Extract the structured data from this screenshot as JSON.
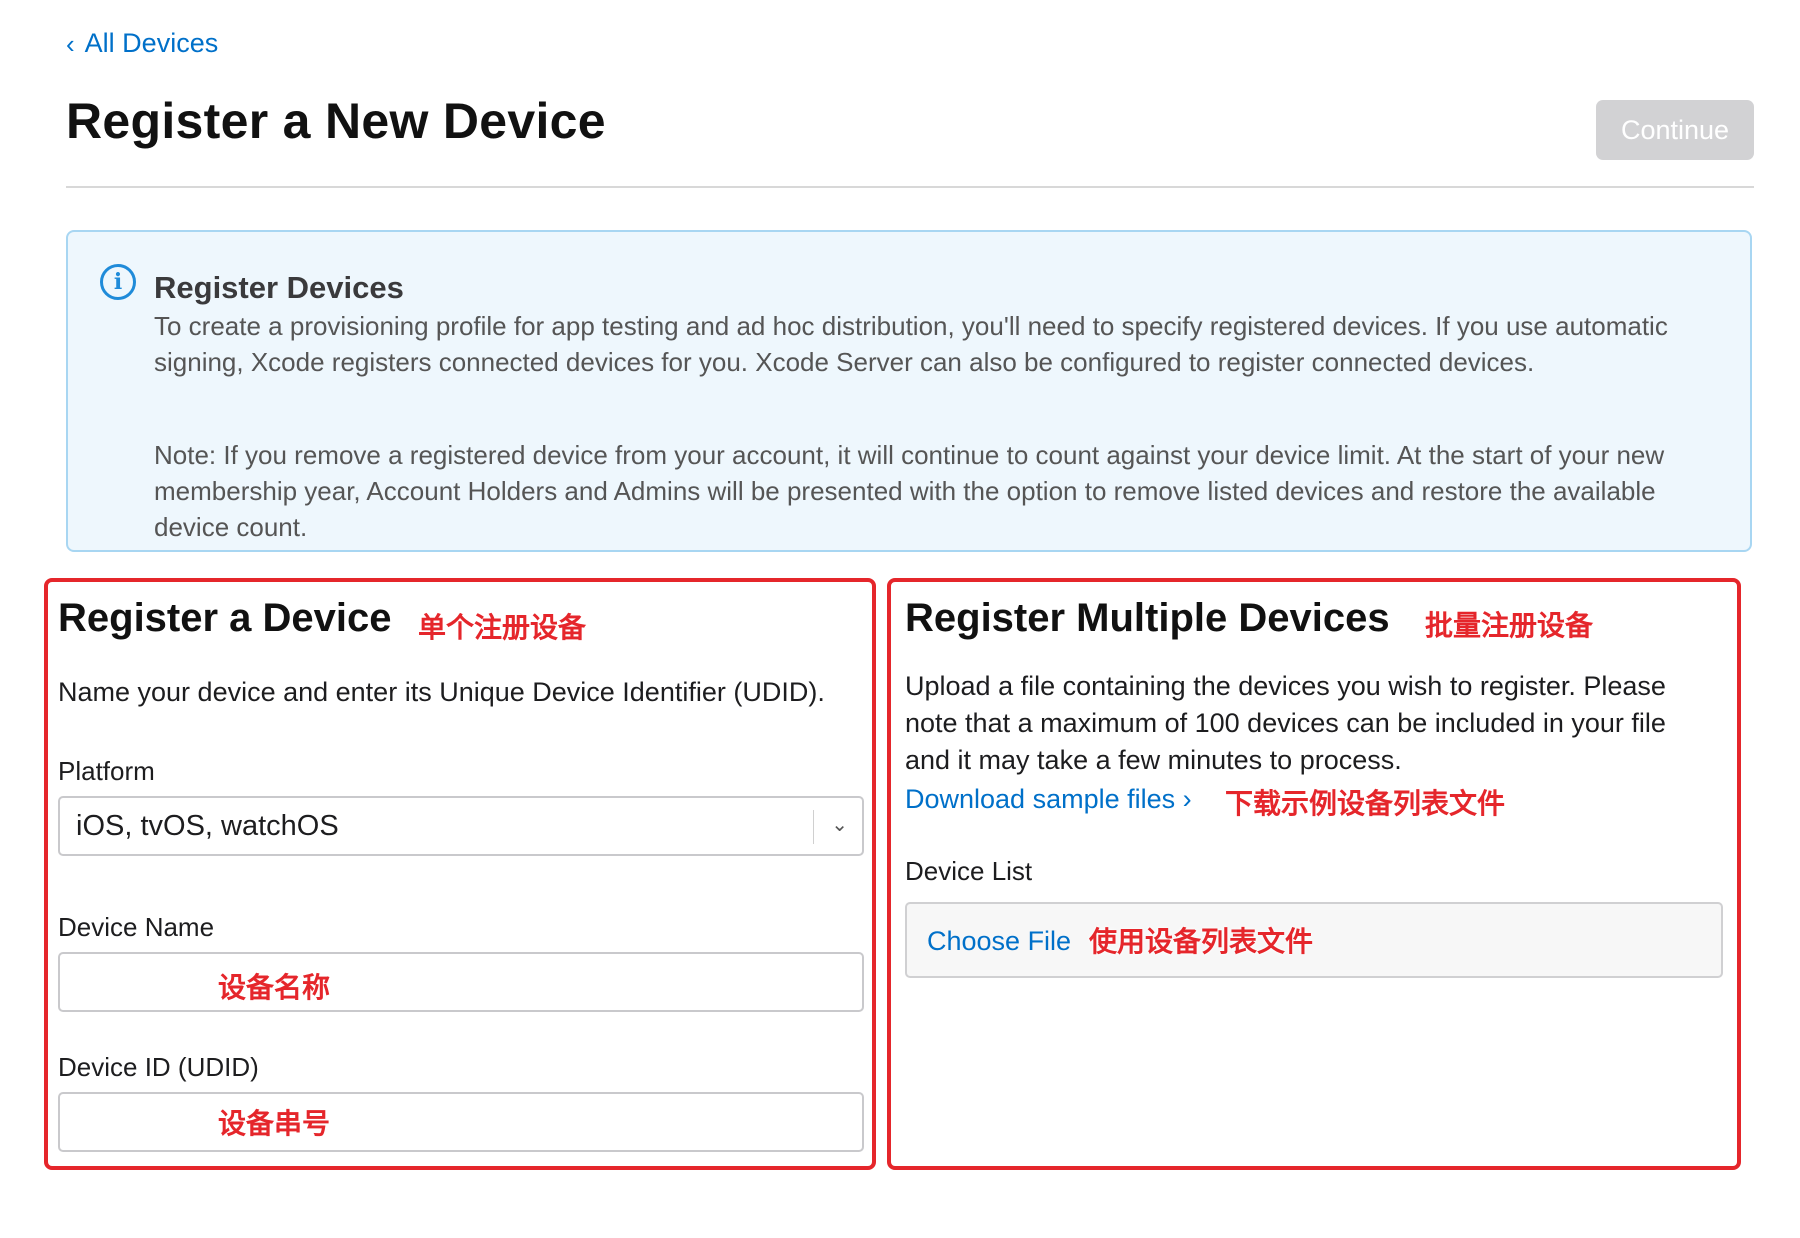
{
  "nav": {
    "back_label": "All Devices",
    "back_icon": "chevron-left-icon"
  },
  "header": {
    "title": "Register a New Device",
    "continue_label": "Continue"
  },
  "info": {
    "title": "Register Devices",
    "paragraph1": "To create a provisioning profile for app testing and ad hoc distribution, you'll need to specify registered devices. If you use automatic signing, Xcode registers connected devices for you. Xcode Server can also be configured to register connected devices.",
    "paragraph2": "Note: If you remove a registered device from your account, it will continue to count against your device limit. At the start of your new membership year, Account Holders and Admins will be presented with the option to remove listed devices and restore the available device count."
  },
  "single": {
    "title": "Register a Device",
    "annotation": "单个注册设备",
    "description": "Name your device and enter its Unique Device Identifier (UDID).",
    "platform_label": "Platform",
    "platform_value": "iOS, tvOS, watchOS",
    "device_name_label": "Device Name",
    "device_name_value": "",
    "device_name_annotation": "设备名称",
    "device_id_label": "Device ID (UDID)",
    "device_id_value": "",
    "device_id_annotation": "设备串号"
  },
  "multiple": {
    "title": "Register Multiple Devices",
    "annotation": "批量注册设备",
    "description": "Upload a file containing the devices you wish to register. Please note that a maximum of 100 devices can be included in your file and it may take a few minutes to process.",
    "download_label": "Download sample files",
    "download_annotation": "下载示例设备列表文件",
    "device_list_label": "Device List",
    "choose_file_label": "Choose File",
    "choose_file_annotation": "使用设备列表文件"
  },
  "colors": {
    "link": "#0070c9",
    "annotation_red": "#e5262b",
    "info_bg": "#eef7fd",
    "info_border": "#a8d6f2",
    "button_disabled": "#d2d2d4"
  }
}
